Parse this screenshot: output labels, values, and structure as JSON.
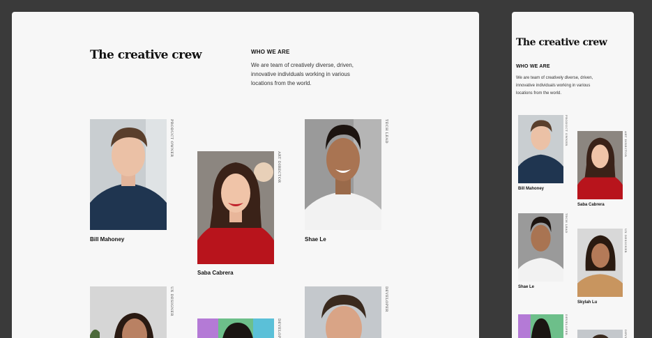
{
  "colors": {
    "page_bg": "#3a3a3a",
    "card_bg": "#f7f7f7",
    "text": "#111111"
  },
  "section": {
    "title": "The creative crew",
    "kicker": "WHO WE ARE",
    "description_lines": [
      "We are team of creatively diverse,  driven,",
      "innovative individuals working in various",
      "locations from the world."
    ]
  },
  "mobile": {
    "description_lines": [
      "We are team of creatively diverse,  driven,",
      "innovative individuals working in various",
      "locations from the world."
    ]
  },
  "team": [
    {
      "name": "Bill Mahoney",
      "role": "PRODUCT OWNER"
    },
    {
      "name": "Saba Cabrera",
      "role": "ART DIRECTOR"
    },
    {
      "name": "Shae Le",
      "role": "TECH LEAD"
    },
    {
      "name": "",
      "role": "UX DESIGNER"
    },
    {
      "name": "",
      "role": "DEVELOPER"
    },
    {
      "name": "",
      "role": "DEVELOPER"
    }
  ],
  "mobile_team": [
    {
      "name": "Bill Mahoney",
      "role": "PRODUCT OWNER"
    },
    {
      "name": "Saba Cabrera",
      "role": "ART DIRECTOR"
    },
    {
      "name": "Shae Le",
      "role": "TECH LEAD"
    },
    {
      "name": "Skylah Lu",
      "role": "UX DESIGNER"
    },
    {
      "name": "",
      "role": "DEVELOPER"
    },
    {
      "name": "",
      "role": "DEVELOPER"
    }
  ]
}
